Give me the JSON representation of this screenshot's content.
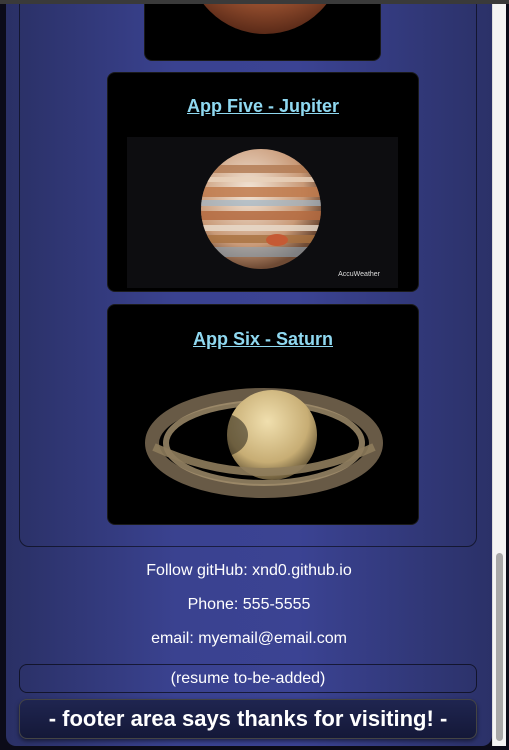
{
  "apps": {
    "jupiter": {
      "title": "App Five - Jupiter",
      "image_credit": "AccuWeather"
    },
    "saturn": {
      "title": "App Six - Saturn"
    }
  },
  "contact": {
    "github": "Follow gitHub: xnd0.github.io",
    "phone": "Phone: 555-5555",
    "email": "email: myemail@email.com"
  },
  "resume": "(resume to-be-added)",
  "footer": "- footer area says thanks for visiting! -",
  "colors": {
    "panel": "#3a4290",
    "link": "#8fd8f0",
    "card": "#000000",
    "text": "#ffffff"
  }
}
